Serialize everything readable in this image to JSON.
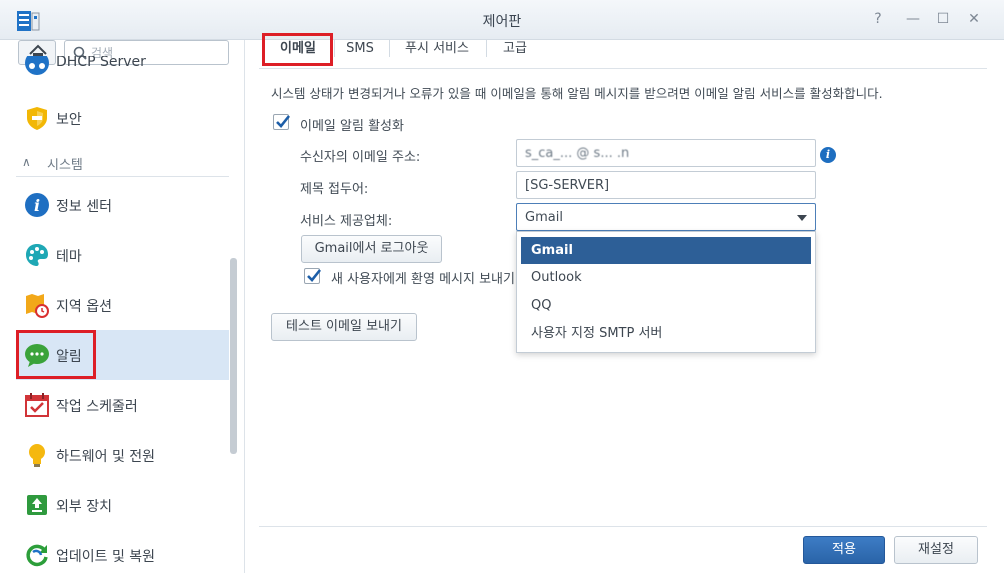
{
  "window": {
    "title": "제어판",
    "controls": {
      "help": "?",
      "minimize": "—",
      "maximize": "☐",
      "close": "✕"
    }
  },
  "sidebar": {
    "search_placeholder": "검색",
    "partial_item": "DHCP Server",
    "items_top": [
      {
        "label": "보안",
        "icon": "shield-icon"
      }
    ],
    "section": {
      "label": "시스템",
      "icon": "chevron-up-icon"
    },
    "items": [
      {
        "label": "정보 센터",
        "icon": "info-icon"
      },
      {
        "label": "테마",
        "icon": "palette-icon"
      },
      {
        "label": "지역 옵션",
        "icon": "map-clock-icon"
      },
      {
        "label": "알림",
        "icon": "chat-bubble-icon",
        "active": true
      },
      {
        "label": "작업 스케줄러",
        "icon": "calendar-check-icon"
      },
      {
        "label": "하드웨어 및 전원",
        "icon": "light-bulb-icon"
      },
      {
        "label": "외부 장치",
        "icon": "upload-device-icon"
      },
      {
        "label": "업데이트 및 복원",
        "icon": "refresh-icon"
      }
    ]
  },
  "tabs": [
    {
      "label": "이메일",
      "active": true
    },
    {
      "label": "SMS"
    },
    {
      "label": "푸시 서비스"
    },
    {
      "label": "고급"
    }
  ],
  "email": {
    "description": "시스템 상태가 변경되거나 오류가 있을 때 이메일을 통해 알림 메시지를 받으려면 이메일 알림 서비스를 활성화합니다.",
    "enable_label": "이메일 알림 활성화",
    "enable_checked": true,
    "recipient_label": "수신자의 이메일 주소:",
    "recipient_value": "s_ca_... @ s... .n",
    "subject_label": "제목 접두어:",
    "subject_value": "[SG-SERVER]",
    "provider_label": "서비스 제공업체:",
    "provider_value": "Gmail",
    "logout_button": "Gmail에서 로그아웃",
    "welcome_label": "새 사용자에게 환영 메시지 보내기",
    "welcome_checked": true,
    "test_button": "테스트 이메일 보내기"
  },
  "dropdown": {
    "options": [
      "Gmail",
      "Outlook",
      "QQ",
      "사용자 지정 SMTP 서버"
    ],
    "selected": "Gmail"
  },
  "footer": {
    "apply": "적용",
    "reset": "재설정"
  },
  "colors": {
    "accent": "#2d5f97",
    "annotation_red": "#dd1e26",
    "sidebar_active": "#d8e6f5"
  }
}
